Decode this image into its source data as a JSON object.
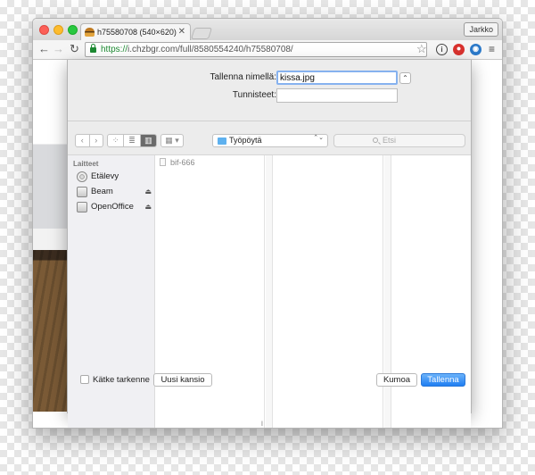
{
  "browser": {
    "tab_title": "h75580708 (540×620)",
    "tab_close": "✕",
    "profile_name": "Jarkko",
    "url_scheme": "https://",
    "url_rest": "i.chzbgr.com/full/8580554240/h75580708/",
    "nav_back": "←",
    "nav_forward": "→",
    "nav_reload": "↻",
    "star": "☆",
    "menu": "≡",
    "ext_info": "i",
    "ext_stop": "⏺",
    "ext_globe": "◉"
  },
  "dialog": {
    "save_as_label": "Tallenna nimellä:",
    "save_as_value": "kissa.jpg",
    "tags_label": "Tunnisteet:",
    "tags_value": "",
    "expand": "⌃",
    "nav_back_glyph": "‹",
    "nav_forward_glyph": "›",
    "view_icons": "⁘",
    "view_list": "≣",
    "view_columns": "▥",
    "view_gallery": "▦ ▾",
    "location": "Työpöytä",
    "location_arrows": "⌃⌄",
    "search_placeholder": "Etsi",
    "sidebar_heading": "Laitteet",
    "sidebar_items": [
      {
        "label": "Etälevy",
        "icon": "remote-disk-icon",
        "eject": ""
      },
      {
        "label": "Beam",
        "icon": "drive-icon",
        "eject": "⏏"
      },
      {
        "label": "OpenOffice",
        "icon": "drive-icon",
        "eject": "⏏"
      }
    ],
    "files": [
      {
        "name": "bif-666",
        "icon": "file-icon"
      }
    ],
    "column_handle": "ll",
    "hide_extension_label": "Kätke tarkenne",
    "new_folder_label": "Uusi kansio",
    "cancel_label": "Kumoa",
    "save_label": "Tallenna"
  },
  "colors": {
    "accent": "#1e7ef2",
    "focus_ring": "#86b2ef",
    "secure": "#1e8b33"
  }
}
